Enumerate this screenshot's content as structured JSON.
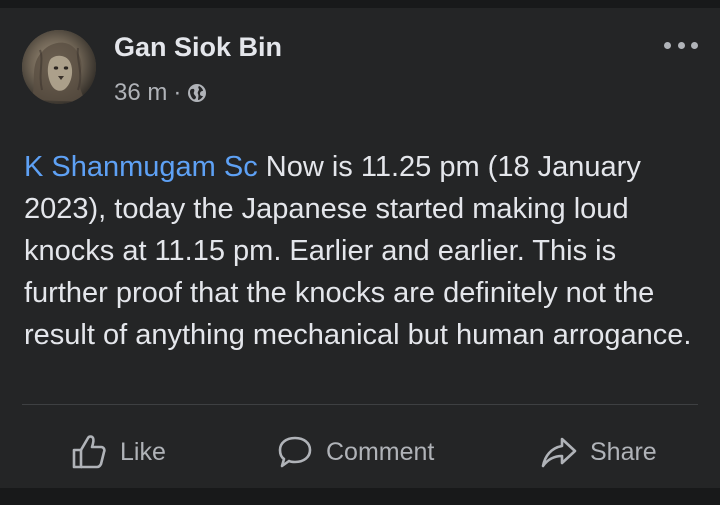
{
  "post": {
    "author": "Gan Siok Bin",
    "time": "36 m",
    "separator": "·",
    "privacy_icon": "globe-icon",
    "menu_icon": "more-options-icon",
    "mention": "K Shanmugam Sc",
    "text": " Now is 11.25 pm (18 January 2023), today the Japanese started making loud knocks at 11.15 pm. Earlier and earlier. This is further proof that the knocks are definitely not the result of anything mechanical but human arrogance."
  },
  "actions": {
    "like_label": "Like",
    "comment_label": "Comment",
    "share_label": "Share"
  },
  "colors": {
    "background": "#18191a",
    "card": "#242526",
    "text": "#e4e6eb",
    "secondary_text": "#b0b3b8",
    "mention": "#5ea1f5",
    "divider": "#3e4042"
  }
}
